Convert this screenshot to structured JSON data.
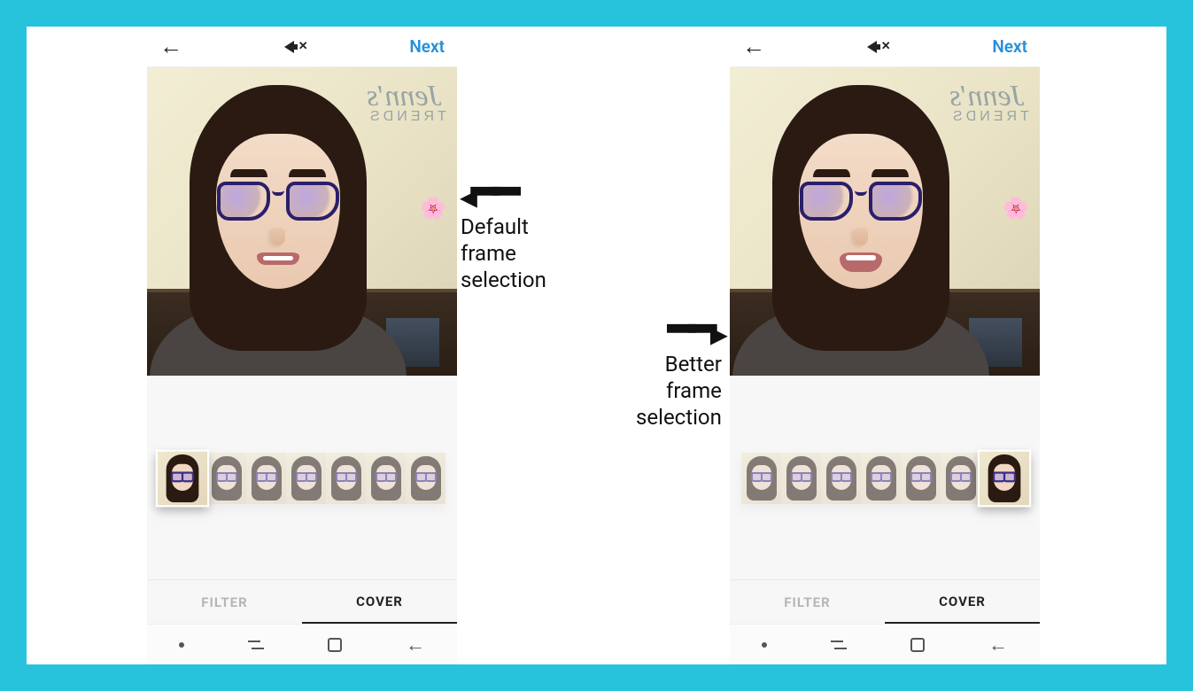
{
  "frame": {
    "outer_color": "#27c3dd"
  },
  "topbar": {
    "back_icon": "arrow-left",
    "mute_icon": "speaker-muted",
    "next_label": "Next"
  },
  "wall_sign": {
    "line1": "Jenn's",
    "line2": "TRENDS"
  },
  "filmstrip": {
    "frame_count": 7,
    "left_selected_index": 0,
    "right_selected_index": 6
  },
  "tabs": {
    "filter_label": "FILTER",
    "cover_label": "COVER",
    "active": "COVER"
  },
  "annotations": {
    "left_text": "Default\nframe\nselection",
    "right_text": "Better\nframe\nselection"
  }
}
